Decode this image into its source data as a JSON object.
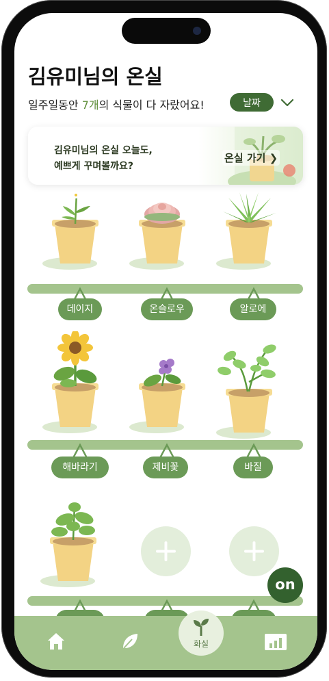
{
  "header": {
    "title": "김유미님의 온실",
    "subtitle_prefix": "일주일동안 ",
    "subtitle_count": "7개",
    "subtitle_suffix": "의 식물이 다 자랐어요!",
    "sort_button": "날짜"
  },
  "banner": {
    "line1": "김유미님의 온실 오늘도,",
    "line2": "예쁘게 꾸며볼까요?",
    "link": "온실 가기"
  },
  "shelves": [
    {
      "plants": [
        "데이지",
        "온슬로우",
        "알로에"
      ]
    },
    {
      "plants": [
        "해바라기",
        "제비꽃",
        "바질"
      ]
    },
    {
      "plants": [
        "",
        "",
        ""
      ]
    }
  ],
  "fab": {
    "label": "on"
  },
  "tabbar": {
    "items": [
      {
        "name": "home",
        "icon": "home-icon"
      },
      {
        "name": "plants",
        "icon": "leaf-icon"
      },
      {
        "name": "greenhouse",
        "icon": "sprout-icon",
        "label": "화실"
      },
      {
        "name": "stats",
        "icon": "chart-icon"
      }
    ]
  },
  "colors": {
    "accent": "#3f6b34",
    "tag": "#6b9a57",
    "shelf": "#a4c48d",
    "highlight": "#5f8f3a"
  }
}
